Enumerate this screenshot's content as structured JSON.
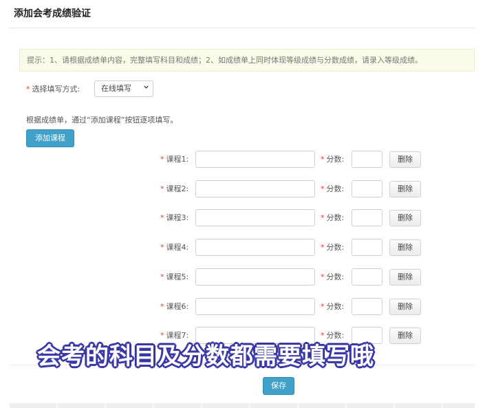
{
  "page": {
    "title": "添加会考成绩验证",
    "hint": "提示：1、请根据成绩单内容，完整填写科目和成绩；2、如成绩单上同时体现等级成绩与分数成绩，请录入等级成绩。"
  },
  "form": {
    "required_mark": "*",
    "method_label": "选择填写方式:",
    "method_value": "在线填写",
    "instruction": "根据成绩单，通过“添加课程”按钮逐项填写。",
    "add_course_label": "添加课程",
    "score_label": "分数:",
    "delete_label": "删除",
    "courses": [
      {
        "label": "课程1:"
      },
      {
        "label": "课程2:"
      },
      {
        "label": "课程3:"
      },
      {
        "label": "课程4:"
      },
      {
        "label": "课程5:"
      },
      {
        "label": "课程6:"
      },
      {
        "label": "课程7:"
      }
    ],
    "save_label": "保存"
  },
  "overlay": {
    "caption": "会考的科目及分数都需要填写哦"
  },
  "colors": {
    "accent": "#3fa0c8",
    "required": "#e0403a",
    "hint_bg": "#fbfbe9",
    "caption_outline": "#3c3aa8"
  }
}
